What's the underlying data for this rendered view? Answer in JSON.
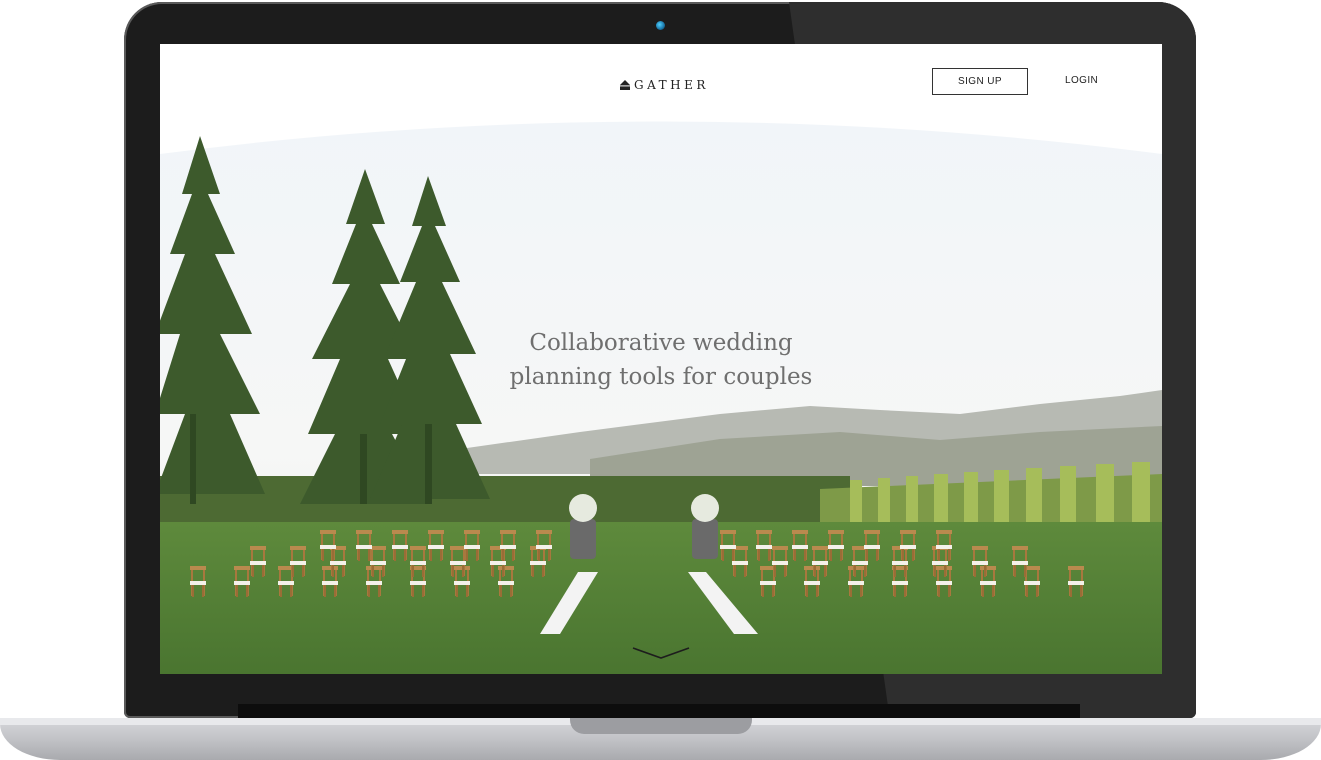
{
  "brand": {
    "name": "GATHER"
  },
  "nav": {
    "signup_label": "SIGN UP",
    "login_label": "LOGIN"
  },
  "hero": {
    "headline_line1": "Collaborative wedding",
    "headline_line2": "planning tools for couples",
    "image_subject": "outdoor wedding ceremony lawn with wooden chairs, aisle of petals, floral arrangements on barrels, tall trees and hills"
  },
  "icons": {
    "logo": "house-icon",
    "scroll": "chevron-down-icon"
  },
  "colors": {
    "text_dark": "#222222",
    "headline": "#6f6f6f",
    "lawn": "#4f7a33",
    "sky": "#eef2f5"
  }
}
